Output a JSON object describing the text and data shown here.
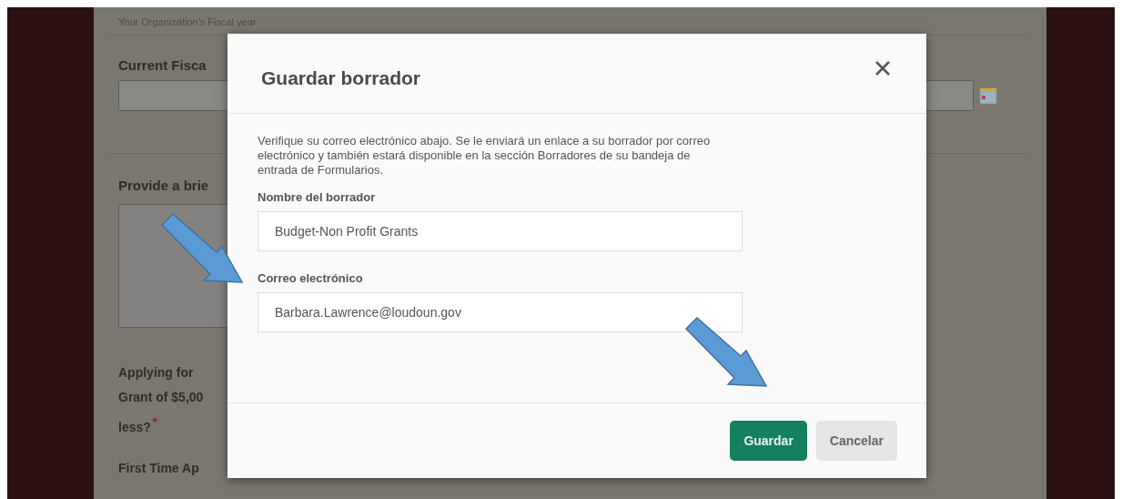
{
  "background_form": {
    "caption": "Your Organization's Fiscal year",
    "field_label": "Current Fisca",
    "question_label": "Provide a brie",
    "grant_question": [
      "Applying for ",
      "Grant of $5,00",
      "less?"
    ],
    "required_mark": "*",
    "next_label": "First Time Ap"
  },
  "dialog": {
    "title": "Guardar borrador",
    "message": "Verifique su correo electrónico abajo. Se le enviará un enlace a su borrador por correo electrónico y también estará disponible en la sección Borradores de su bandeja de entrada de Formularios.",
    "fields": [
      {
        "label": "Nombre del borrador",
        "value": "Budget-Non Profit Grants"
      },
      {
        "label": "Correo electrónico",
        "value": "Barbara.Lawrence@loudoun.gov"
      }
    ],
    "buttons": [
      {
        "label": "Guardar",
        "kind": "primary"
      },
      {
        "label": "Cancelar",
        "kind": "secondary"
      }
    ]
  }
}
